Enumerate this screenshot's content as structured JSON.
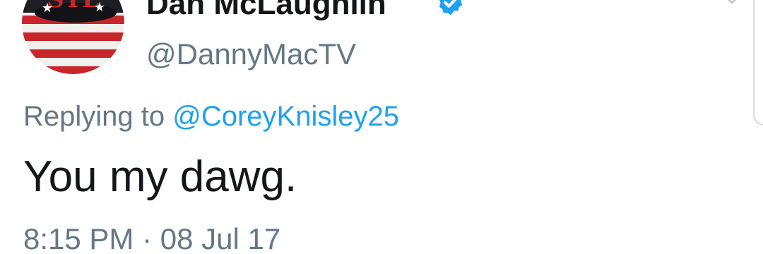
{
  "tweet": {
    "author": {
      "display_name": "Dan McLaughlin",
      "verified_icon": "verified-badge-icon",
      "handle": "@DannyMacTV"
    },
    "reply": {
      "prefix": "Replying to",
      "mention": "@CoreyKnisley25"
    },
    "text": "You my dawg.",
    "timestamp": "8:15 PM · 08 Jul 17",
    "menu_icon": "chevron-down-icon"
  },
  "colors": {
    "text_primary": "#14171a",
    "text_secondary": "#657786",
    "accent": "#1da1f2"
  }
}
